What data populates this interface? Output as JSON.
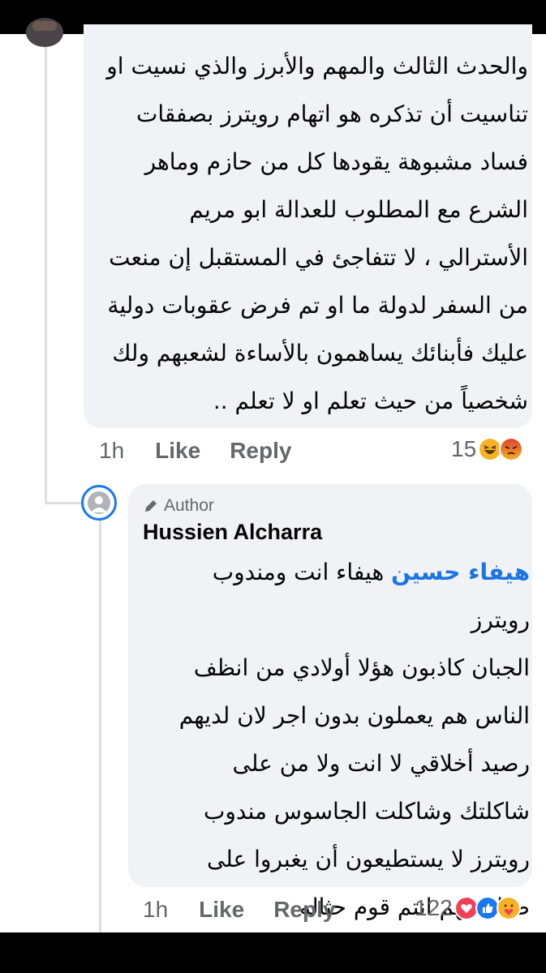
{
  "comment1": {
    "lines": [
      "والحدث الثالث والمهم والأبرز والذي نسيت او",
      "تناسيت أن تذكره هو اتهام رويترز بصفقات",
      "فساد مشبوهة يقودها كل من حازم وماهر",
      "الشرع مع المطلوب للعدالة ابو مريم",
      "الأسترالي ، لا تتفاجئ في المستقبل إن منعت",
      "من السفر لدولة ما او تم فرض عقوبات دولية",
      "عليك فأبنائك يساهمون بالأساءة لشعبهم ولك",
      "شخصياً من حيث تعلم او لا تعلم .."
    ],
    "time": "1h",
    "like_label": "Like",
    "reply_label": "Reply",
    "reaction_count": "15",
    "reactions": [
      "haha-icon",
      "angry-icon"
    ]
  },
  "comment2": {
    "author_badge": "Author",
    "author_name": "Hussien Alcharra",
    "mention": "هيفاء حسين",
    "first_line_rest": " هيفاء انت ومندوب رويترز",
    "lines": [
      "الجبان كاذبون هؤلا أولادي من انظف",
      "الناس هم يعملون بدون اجر لان لديهم",
      "رصيد أخلاقي لا انت ولا من على",
      "شاكلتك وشاكلت الجاسوس مندوب",
      "رويترز لا يستطيعون أن يغبروا على",
      "صبابيطهم انتم قوم حثاله"
    ],
    "time": "1h",
    "like_label": "Like",
    "reply_label": "Reply",
    "reaction_count": "122",
    "reactions": [
      "love-icon",
      "like-icon",
      "care-icon"
    ]
  },
  "colors": {
    "bubble": "#f0f2f5",
    "mention": "#1b74e4",
    "meta": "#65676b",
    "author_ring": "#1877f2"
  }
}
